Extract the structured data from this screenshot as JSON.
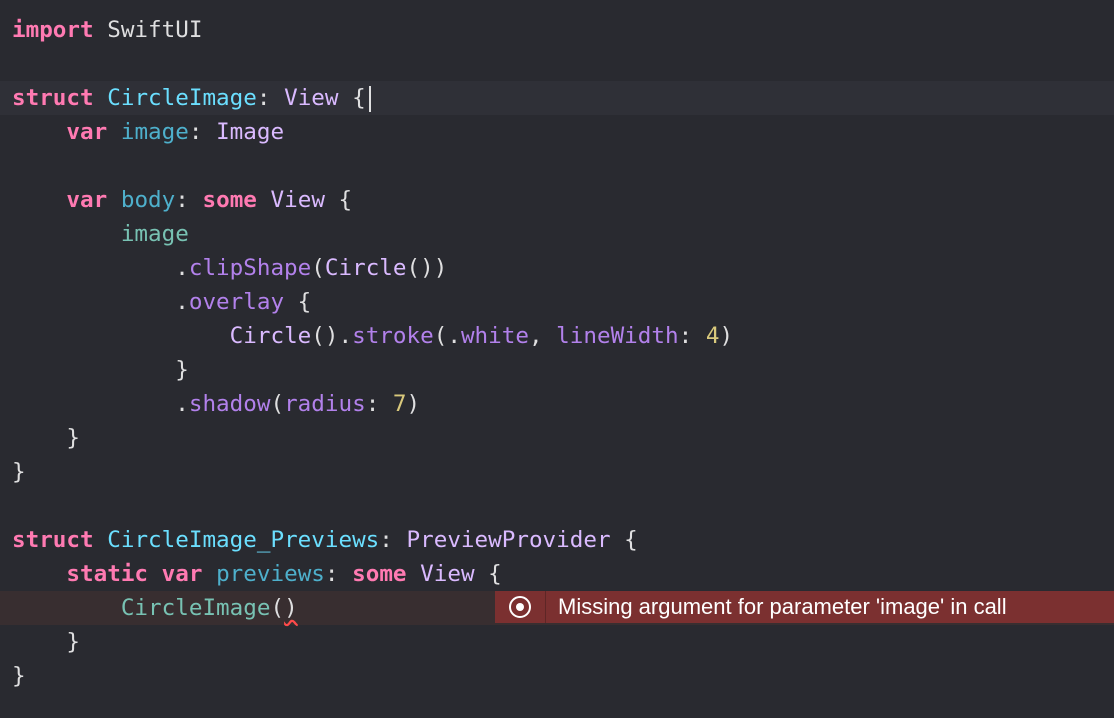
{
  "editor": {
    "lines": [
      {
        "tokens": [
          {
            "t": "import",
            "c": "kw"
          },
          {
            "t": " SwiftUI",
            "c": "plain"
          }
        ]
      },
      {
        "tokens": []
      },
      {
        "current": true,
        "cursor": true,
        "tokens": [
          {
            "t": "struct",
            "c": "kw"
          },
          {
            "t": " ",
            "c": "plain"
          },
          {
            "t": "CircleImage",
            "c": "ty"
          },
          {
            "t": ": ",
            "c": "plain"
          },
          {
            "t": "View",
            "c": "sys"
          },
          {
            "t": " {",
            "c": "plain"
          }
        ]
      },
      {
        "tokens": [
          {
            "t": "    ",
            "c": "plain"
          },
          {
            "t": "var",
            "c": "kw"
          },
          {
            "t": " ",
            "c": "plain"
          },
          {
            "t": "image",
            "c": "prop"
          },
          {
            "t": ": ",
            "c": "plain"
          },
          {
            "t": "Image",
            "c": "sys"
          }
        ]
      },
      {
        "tokens": []
      },
      {
        "tokens": [
          {
            "t": "    ",
            "c": "plain"
          },
          {
            "t": "var",
            "c": "kw"
          },
          {
            "t": " ",
            "c": "plain"
          },
          {
            "t": "body",
            "c": "prop"
          },
          {
            "t": ": ",
            "c": "plain"
          },
          {
            "t": "some",
            "c": "kw"
          },
          {
            "t": " ",
            "c": "plain"
          },
          {
            "t": "View",
            "c": "sys"
          },
          {
            "t": " {",
            "c": "plain"
          }
        ]
      },
      {
        "tokens": [
          {
            "t": "        ",
            "c": "plain"
          },
          {
            "t": "image",
            "c": "attr"
          }
        ]
      },
      {
        "tokens": [
          {
            "t": "            .",
            "c": "plain"
          },
          {
            "t": "clipShape",
            "c": "meth"
          },
          {
            "t": "(",
            "c": "plain"
          },
          {
            "t": "Circle",
            "c": "sys"
          },
          {
            "t": "())",
            "c": "plain"
          }
        ]
      },
      {
        "tokens": [
          {
            "t": "            .",
            "c": "plain"
          },
          {
            "t": "overlay",
            "c": "meth"
          },
          {
            "t": " {",
            "c": "plain"
          }
        ]
      },
      {
        "tokens": [
          {
            "t": "                ",
            "c": "plain"
          },
          {
            "t": "Circle",
            "c": "sys"
          },
          {
            "t": "().",
            "c": "plain"
          },
          {
            "t": "stroke",
            "c": "meth"
          },
          {
            "t": "(.",
            "c": "plain"
          },
          {
            "t": "white",
            "c": "meth"
          },
          {
            "t": ", ",
            "c": "plain"
          },
          {
            "t": "lineWidth",
            "c": "meth"
          },
          {
            "t": ": ",
            "c": "plain"
          },
          {
            "t": "4",
            "c": "num"
          },
          {
            "t": ")",
            "c": "plain"
          }
        ]
      },
      {
        "tokens": [
          {
            "t": "            }",
            "c": "plain"
          }
        ]
      },
      {
        "tokens": [
          {
            "t": "            .",
            "c": "plain"
          },
          {
            "t": "shadow",
            "c": "meth"
          },
          {
            "t": "(",
            "c": "plain"
          },
          {
            "t": "radius",
            "c": "meth"
          },
          {
            "t": ": ",
            "c": "plain"
          },
          {
            "t": "7",
            "c": "num"
          },
          {
            "t": ")",
            "c": "plain"
          }
        ]
      },
      {
        "tokens": [
          {
            "t": "    }",
            "c": "plain"
          }
        ]
      },
      {
        "tokens": [
          {
            "t": "}",
            "c": "plain"
          }
        ]
      },
      {
        "tokens": []
      },
      {
        "tokens": [
          {
            "t": "struct",
            "c": "kw"
          },
          {
            "t": " ",
            "c": "plain"
          },
          {
            "t": "CircleImage_Previews",
            "c": "ty"
          },
          {
            "t": ": ",
            "c": "plain"
          },
          {
            "t": "PreviewProvider",
            "c": "sys"
          },
          {
            "t": " {",
            "c": "plain"
          }
        ]
      },
      {
        "tokens": [
          {
            "t": "    ",
            "c": "plain"
          },
          {
            "t": "static",
            "c": "kw"
          },
          {
            "t": " ",
            "c": "plain"
          },
          {
            "t": "var",
            "c": "kw"
          },
          {
            "t": " ",
            "c": "plain"
          },
          {
            "t": "previews",
            "c": "prop"
          },
          {
            "t": ": ",
            "c": "plain"
          },
          {
            "t": "some",
            "c": "kw"
          },
          {
            "t": " ",
            "c": "plain"
          },
          {
            "t": "View",
            "c": "sys"
          },
          {
            "t": " {",
            "c": "plain"
          }
        ]
      },
      {
        "error": true,
        "tokens": [
          {
            "t": "        ",
            "c": "plain"
          },
          {
            "t": "CircleImage",
            "c": "attr"
          },
          {
            "t": "(",
            "c": "plain"
          },
          {
            "t": ")",
            "c": "plain squiggle"
          }
        ]
      },
      {
        "tokens": [
          {
            "t": "    }",
            "c": "plain"
          }
        ]
      },
      {
        "tokens": [
          {
            "t": "}",
            "c": "plain"
          }
        ]
      }
    ]
  },
  "error_banner": {
    "icon": "error-circle-icon",
    "message": "Missing argument for parameter 'image' in call",
    "color": "#7b3030"
  },
  "colors": {
    "background": "#292a30",
    "keyword": "#ff7ab2",
    "type_decl": "#6bdfff",
    "system_type": "#dabaff",
    "property": "#4eb0cc",
    "method": "#b281eb",
    "number": "#d9c97c"
  }
}
